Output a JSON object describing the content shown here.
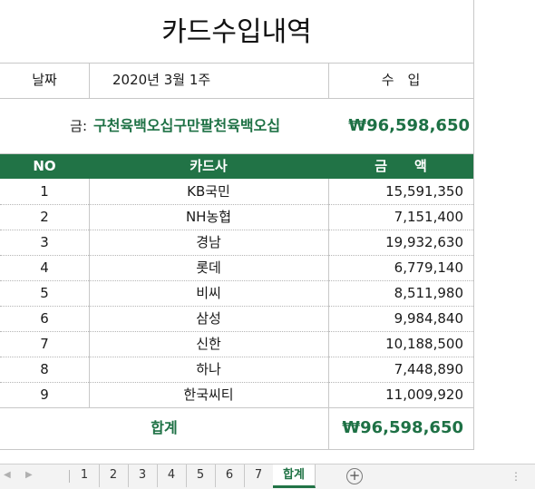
{
  "sheet": {
    "title": "카드수입내역",
    "date_label": "날짜",
    "date_value": "2020년 3월 1주",
    "income_label": "수　입",
    "amount_prefix": "금:",
    "amount_in_words": "구천육백오십구만팔천육백오십",
    "amount_total_top": "₩96,598,650",
    "columns": {
      "no": "NO",
      "card": "카드사",
      "amount": "금　　액"
    },
    "rows": [
      {
        "no": "1",
        "card": "KB국민",
        "amount": "15,591,350"
      },
      {
        "no": "2",
        "card": "NH농협",
        "amount": "7,151,400"
      },
      {
        "no": "3",
        "card": "경남",
        "amount": "19,932,630"
      },
      {
        "no": "4",
        "card": "롯데",
        "amount": "6,779,140"
      },
      {
        "no": "5",
        "card": "비씨",
        "amount": "8,511,980"
      },
      {
        "no": "6",
        "card": "삼성",
        "amount": "9,984,840"
      },
      {
        "no": "7",
        "card": "신한",
        "amount": "10,188,500"
      },
      {
        "no": "8",
        "card": "하나",
        "amount": "7,448,890"
      },
      {
        "no": "9",
        "card": "한국씨티",
        "amount": "11,009,920"
      }
    ],
    "total_label": "합계",
    "total_value": "₩96,598,650"
  },
  "tabs": {
    "prev_icon": "triangle-left-icon",
    "next_icon": "triangle-right-icon",
    "items": [
      "1",
      "2",
      "3",
      "4",
      "5",
      "6",
      "7",
      "합계"
    ],
    "active": "합계",
    "add_icon": "plus-circle-icon"
  },
  "colors": {
    "accent_green": "#217346",
    "text_green": "#1e7145",
    "grid": "#c8c8c8"
  }
}
